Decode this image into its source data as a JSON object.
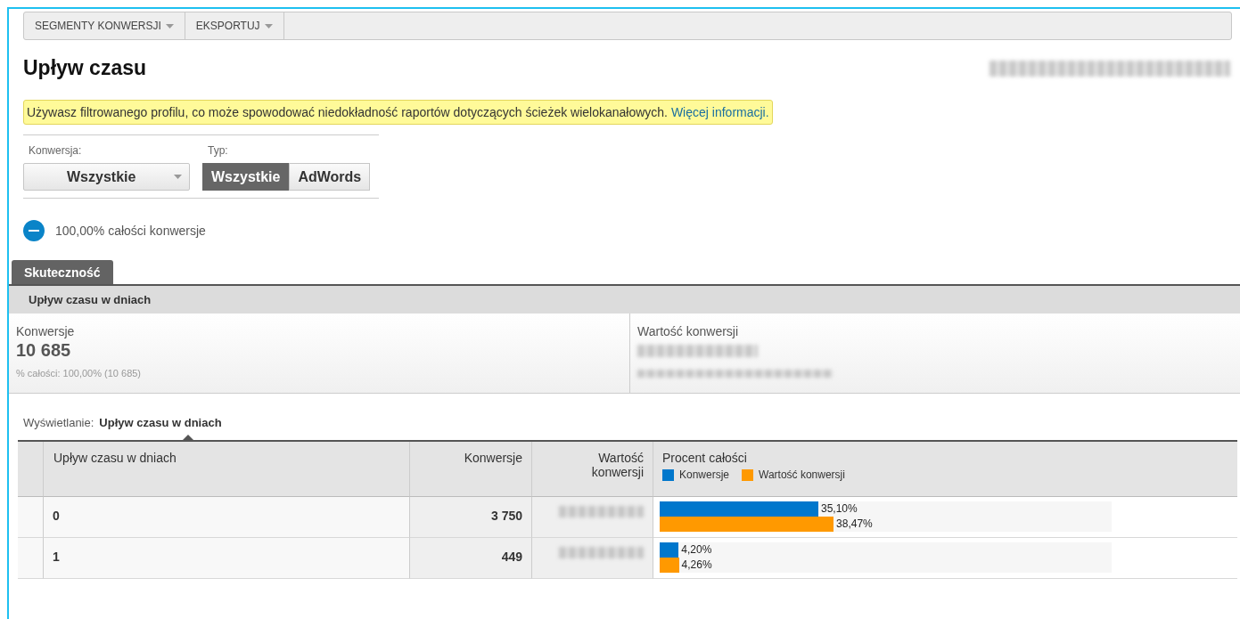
{
  "toolbar": {
    "buttons": [
      {
        "label": "SEGMENTY KONWERSJI"
      },
      {
        "label": "EKSPORTUJ"
      }
    ]
  },
  "title": "Upływ czasu",
  "notice": {
    "text": "Używasz filtrowanego profilu, co może spowodować niedokładność raportów dotyczących ścieżek wielokanałowych.",
    "link": "Więcej informacji."
  },
  "filters": {
    "conversion": {
      "label": "Konwersja:",
      "value": "Wszystkie"
    },
    "type": {
      "label": "Typ:",
      "options": [
        {
          "label": "Wszystkie",
          "selected": true
        },
        {
          "label": "AdWords",
          "selected": false
        }
      ]
    }
  },
  "segment": {
    "text": "100,00% całości konwersje"
  },
  "tabs": [
    {
      "label": "Skuteczność",
      "selected": true
    }
  ],
  "subtabs": [
    {
      "label": "Upływ czasu w dniach",
      "selected": true
    }
  ],
  "scorecards": [
    {
      "label": "Konwersje",
      "value": "10 685",
      "detail": "% całości: 100,00% (10 685)"
    },
    {
      "label": "Wartość konwersji"
    }
  ],
  "view": {
    "label": "Wyświetlanie:",
    "value": "Upływ czasu w dniach"
  },
  "table": {
    "columns": [
      "Upływ czasu w dniach",
      "Konwersje",
      "Wartość konwersji",
      "Procent całości"
    ],
    "legend": [
      {
        "label": "Konwersje",
        "color": "#0077cc"
      },
      {
        "label": "Wartość konwersji",
        "color": "#ff9900"
      }
    ],
    "rows": [
      {
        "days": "0",
        "conversions": "3 750",
        "bars": [
          {
            "level": 0.351,
            "label": "35,10%"
          },
          {
            "level": 0.3847,
            "label": "38,47%"
          }
        ]
      },
      {
        "days": "1",
        "conversions": "449",
        "bars": [
          {
            "level": 0.042,
            "label": "4,20%"
          },
          {
            "level": 0.0426,
            "label": "4,26%"
          }
        ]
      }
    ]
  }
}
